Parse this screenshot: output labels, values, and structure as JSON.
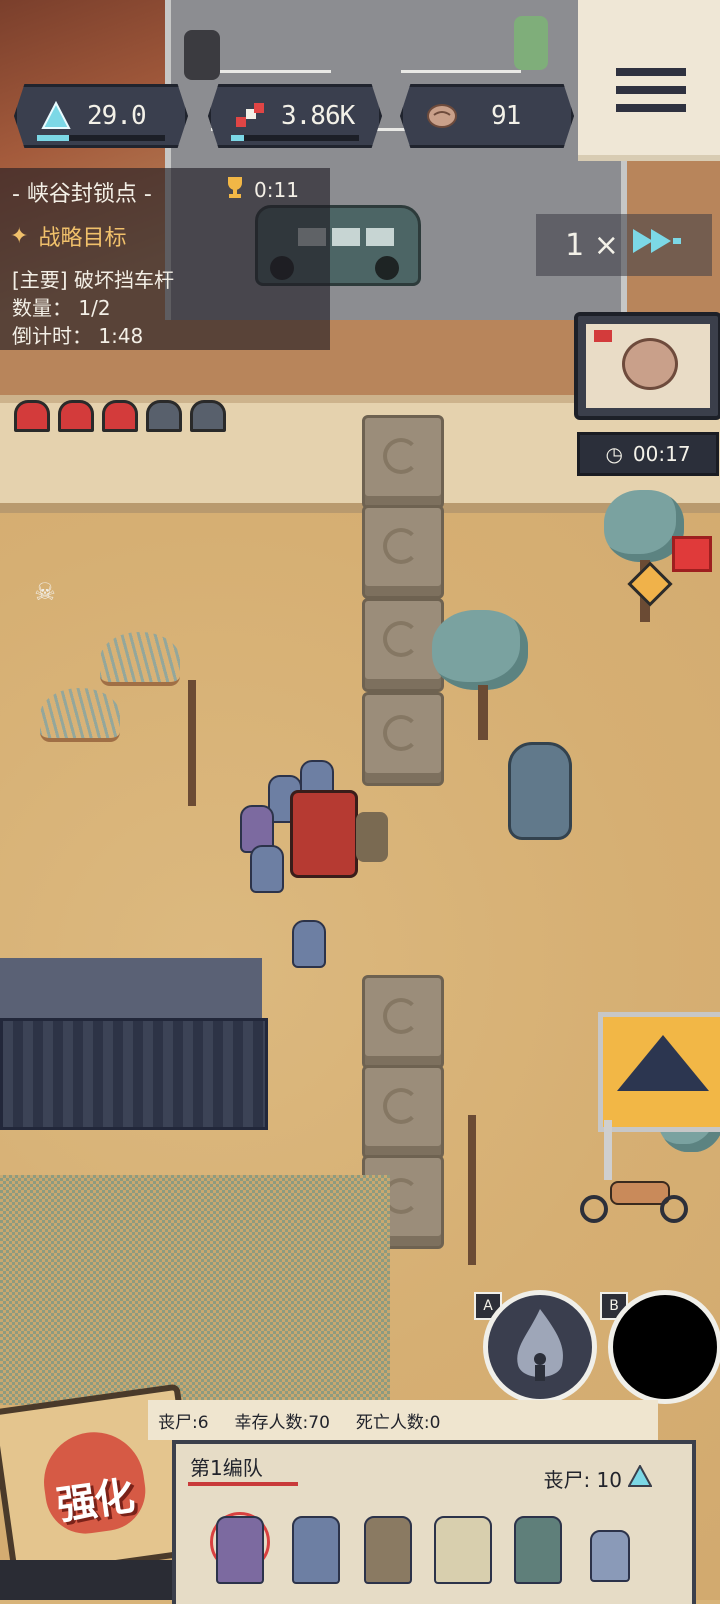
{
  "resources": {
    "crystal": {
      "value": "29.0",
      "icon": "crystal-icon",
      "fill": 0.25
    },
    "dna": {
      "value": "3.86K",
      "icon": "dna-icon",
      "fill": 0.1
    },
    "brain": {
      "value": "91",
      "icon": "brain-icon",
      "fill": 0.0
    }
  },
  "stage": {
    "title": "- 峡谷封锁点 -",
    "trophy_time": "0:11",
    "objective_header": "战略目标",
    "objective_lines": [
      "[主要] 破坏挡车杆",
      "数量： 1/2",
      "倒计时： 1:48"
    ]
  },
  "speed": {
    "label": "1 ×"
  },
  "event": {
    "timer": "00:17"
  },
  "helmets": {
    "total": 5,
    "active": 3
  },
  "skills": {
    "a_key": "A",
    "b_key": "B"
  },
  "stats": {
    "zombies": "丧尸:6",
    "survivors": "幸存人数:70",
    "deaths": "死亡人数:0"
  },
  "squad": {
    "title": "第1编队",
    "count_label": "丧尸: 10"
  },
  "upgrade": {
    "label": "强化"
  },
  "colors": {
    "accent": "#7cd8e6",
    "danger": "#d84040",
    "hud_bg": "#3a3f4e"
  }
}
